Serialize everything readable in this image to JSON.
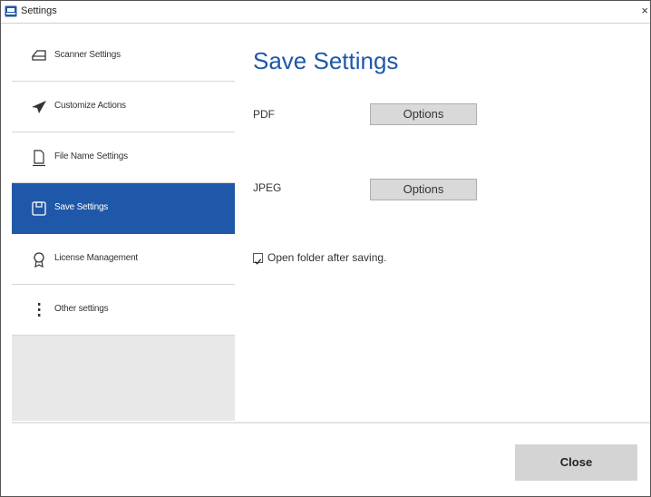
{
  "window": {
    "title": "Settings",
    "close_glyph": "×"
  },
  "sidebar": {
    "items": [
      {
        "label": "Scanner Settings",
        "icon": "scanner-icon",
        "active": false
      },
      {
        "label": "Customize Actions",
        "icon": "send-icon",
        "active": false
      },
      {
        "label": "File Name Settings",
        "icon": "document-icon",
        "active": false
      },
      {
        "label": "Save Settings",
        "icon": "save-icon",
        "active": true
      },
      {
        "label": "License Management",
        "icon": "award-icon",
        "active": false
      },
      {
        "label": "Other settings",
        "icon": "more-vertical-icon",
        "active": false
      }
    ]
  },
  "main": {
    "title": "Save Settings",
    "rows": [
      {
        "label": "PDF",
        "button_label": "Options"
      },
      {
        "label": "JPEG",
        "button_label": "Options"
      }
    ],
    "open_folder": {
      "label": "Open folder after saving.",
      "checked": true
    }
  },
  "footer": {
    "close_label": "Close"
  },
  "colors": {
    "accent": "#1f58a8",
    "sidebar_bg": "#e8e8e8",
    "button_bg": "#d9d9d9"
  }
}
